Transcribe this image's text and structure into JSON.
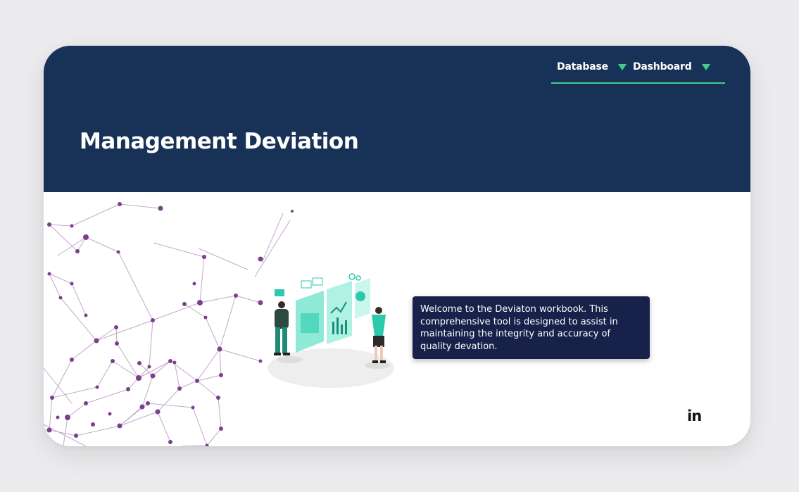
{
  "nav": {
    "items": [
      {
        "label": "Database",
        "icon": "caret-down-icon"
      },
      {
        "label": "Dashboard",
        "icon": "caret-down-icon"
      }
    ]
  },
  "header": {
    "title": "Management Deviation"
  },
  "main": {
    "welcome_text": "Welcome to the Deviaton workbook. This comprehensive tool is designed to assist in maintaining the integrity and accuracy of quality devation."
  },
  "footer": {
    "linkedin_label": "in",
    "linkedin_icon": "linkedin-icon"
  },
  "colors": {
    "header_bg": "#183157",
    "accent": "#3ecf8e",
    "tooltip_bg": "#17214a",
    "network": "#7b3f8c",
    "page_bg": "#ececee"
  }
}
